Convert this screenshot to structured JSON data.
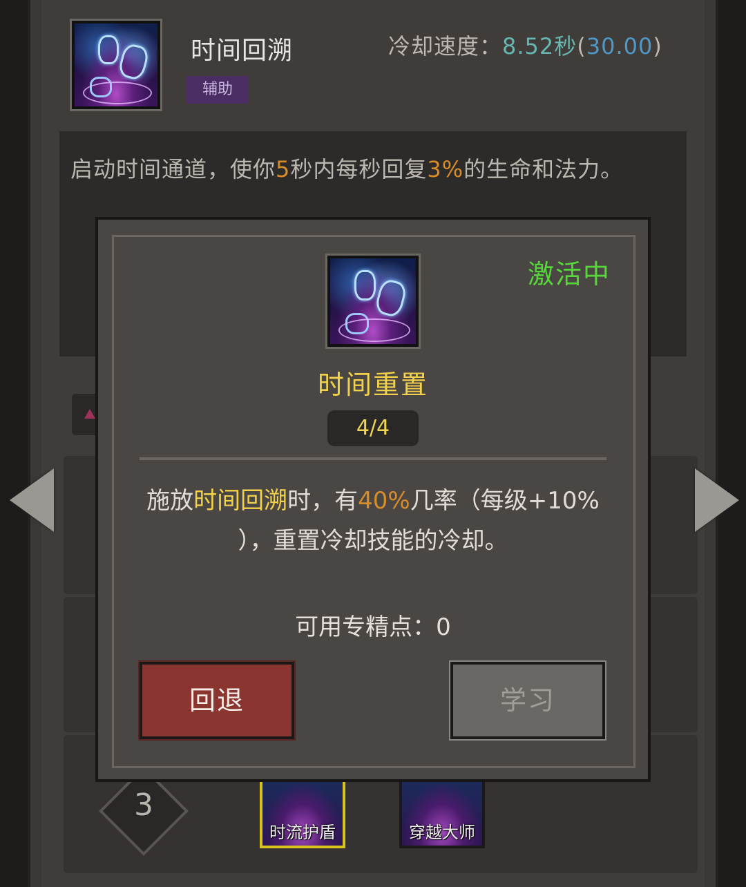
{
  "skill": {
    "title": "时间回溯",
    "tag": "辅助",
    "cooldown_label": "冷却速度：",
    "cooldown_value": "8.52秒",
    "cooldown_base": "30.00",
    "description_parts": [
      "启动时间通道，使你",
      "5",
      "秒内每秒回复",
      "3%",
      "的生命和法力。"
    ]
  },
  "tiers": {
    "current_tier": "3",
    "icons": [
      {
        "label": "时流护盾",
        "selected": true
      },
      {
        "label": "穿越大师",
        "selected": false
      }
    ]
  },
  "modal": {
    "status": "激活中",
    "name": "时间重置",
    "level": "4/4",
    "desc_parts": [
      "施放",
      "时间回溯",
      "时，有",
      "40%",
      "几率（每级+10%",
      "），重置冷却技能的冷却。"
    ],
    "points_label": "可用专精点：0",
    "back_button": "回退",
    "learn_button": "学习"
  },
  "colors": {
    "status_green": "#57d83a",
    "gold": "#f2d24a",
    "orange": "#d78c2a",
    "back_red": "#8b3530"
  }
}
